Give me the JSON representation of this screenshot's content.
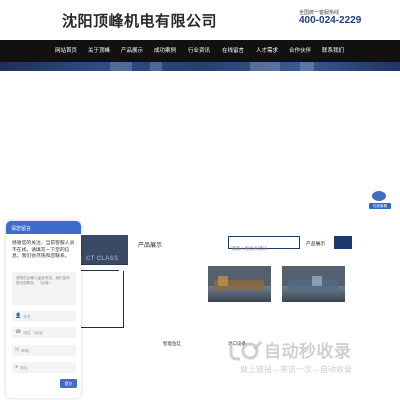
{
  "header": {
    "company_name": "沈阳顶峰机电有限公司",
    "hotline_label": "全国统一客服热线",
    "hotline_number": "400-024-2229"
  },
  "nav": {
    "items": [
      "网站首页",
      "关于顶峰",
      "产品展示",
      "成功案例",
      "行业资讯",
      "在线留言",
      "人才需求",
      "合作伙伴",
      "联系我们"
    ]
  },
  "floating_service": {
    "label": "在线客服"
  },
  "products": {
    "title": "产品展示",
    "class_text": "CT CLASS",
    "search_placeholder": "请输入搜索关键词",
    "search_label": "产品展示",
    "label_a": "智能鱼缸",
    "label_b": "进口设备"
  },
  "chat": {
    "title": "请您留言",
    "greeting": "感谢您的关注，当前客服人员不在线，请填写一下您的信息，我们会尽快和您联系。",
    "message_placeholder": "请您在此输入留言内容，我们会尽快与您联系。（必填）",
    "name_placeholder": "姓名",
    "phone_placeholder": "电话（必填）",
    "email_placeholder": "邮箱",
    "address_placeholder": "地址",
    "submit_label": "提交"
  },
  "watermark": {
    "title": "自动秒收录",
    "subtitle": "做上链接→来访一次→自动收录"
  },
  "colors": {
    "nav_bg": "#111111",
    "brand_blue": "#1b3f7a",
    "chat_blue": "#3e6ccd"
  }
}
